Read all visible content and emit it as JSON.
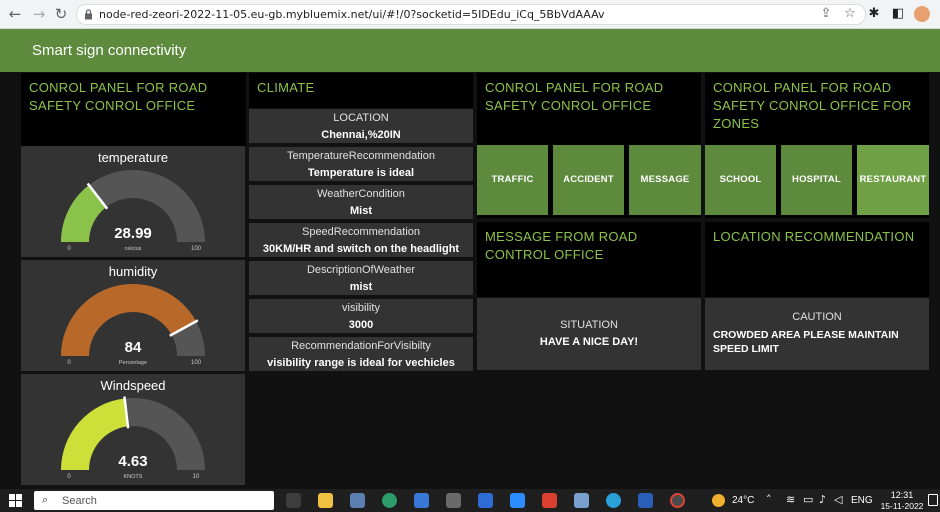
{
  "browser": {
    "url": "node-red-zeori-2022-11-05.eu-gb.mybluemix.net/ui/#!/0?socketid=5IDEdu_iCq_5BbVdAAAv"
  },
  "app": {
    "title": "Smart sign connectivity"
  },
  "groups": {
    "panel1_title": "CONROL PANEL FOR ROAD SAFETY CONROL OFFICE",
    "climate_title": "CLIMATE",
    "panel2_title": "CONROL PANEL FOR ROAD SAFETY CONROL OFFICE",
    "panel3_title": "CONROL PANEL FOR ROAD SAFETY CONROL OFFICE FOR ZONES",
    "message_title": "MESSAGE FROM ROAD CONTROL OFFICE",
    "location_title": "LOCATION RECOMMENDATION"
  },
  "gauges": [
    {
      "title": "temperature",
      "value": "28.99",
      "unit": "celcius",
      "min": "0",
      "max": "100",
      "fraction": 0.29,
      "color": "#8bc34a"
    },
    {
      "title": "humidity",
      "value": "84",
      "unit": "Percentage",
      "min": "0",
      "max": "100",
      "fraction": 0.84,
      "color": "#b8692a"
    },
    {
      "title": "Windspeed",
      "value": "4.63",
      "unit": "KNOTS",
      "min": "0",
      "max": "10",
      "fraction": 0.463,
      "color": "#cde03a"
    }
  ],
  "climate": [
    {
      "label": "LOCATION",
      "value": "Chennai,%20IN"
    },
    {
      "label": "TemperatureRecommendation",
      "value": "Temperature is ideal"
    },
    {
      "label": "WeatherCondition",
      "value": "Mist"
    },
    {
      "label": "SpeedRecommendation",
      "value": "30KM/HR and switch on the headlight"
    },
    {
      "label": "DescriptionOfWeather",
      "value": "mist"
    },
    {
      "label": "visibility",
      "value": "3000"
    },
    {
      "label": "RecommendationForVisibilty",
      "value": "visibility range is ideal for vechicles"
    }
  ],
  "buttons_control": [
    "TRAFFIC",
    "ACCIDENT",
    "MESSAGE"
  ],
  "buttons_zones": [
    "SCHOOL",
    "HOSPITAL",
    "RESTAURANT"
  ],
  "situation": {
    "label": "SITUATION",
    "value": "HAVE A NICE DAY!"
  },
  "caution": {
    "label": "CAUTION",
    "value": "CROWDED AREA PLEASE MAINTAIN SPEED LIMIT"
  },
  "taskbar": {
    "search_placeholder": "Search",
    "temperature": "24°C",
    "language": "ENG",
    "time": "12:31",
    "date": "15-11-2022"
  },
  "colors": {
    "accent": "#5d8a3c",
    "title_green": "#8bc34a",
    "card_bg": "#333333"
  }
}
